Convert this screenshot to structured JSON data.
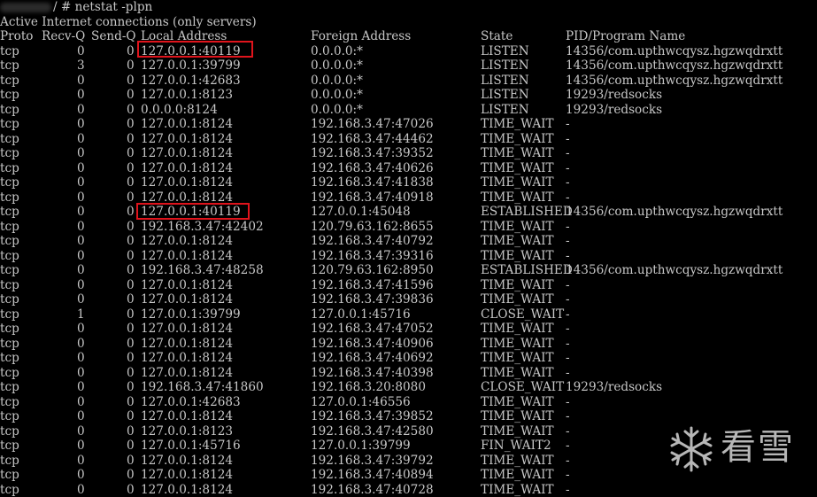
{
  "window": {
    "prompt_text": "/ # netstat -plpn",
    "title_line": "Active Internet connections (only servers)"
  },
  "header": {
    "proto": "Proto",
    "recvq": "Recv-Q",
    "sendq": "Send-Q",
    "local": "Local Address",
    "foreign": "Foreign Address",
    "state": "State",
    "pid": "PID/Program Name"
  },
  "rows": [
    {
      "proto": "tcp",
      "recvq": "0",
      "sendq": "0",
      "local": "127.0.0.1:40119",
      "foreign": "0.0.0.0:*",
      "state": "LISTEN",
      "pid": "14356/com.upthwcqysz.hgzwqdrxtt"
    },
    {
      "proto": "tcp",
      "recvq": "3",
      "sendq": "0",
      "local": "127.0.0.1:39799",
      "foreign": "0.0.0.0:*",
      "state": "LISTEN",
      "pid": "14356/com.upthwcqysz.hgzwqdrxtt"
    },
    {
      "proto": "tcp",
      "recvq": "0",
      "sendq": "0",
      "local": "127.0.0.1:42683",
      "foreign": "0.0.0.0:*",
      "state": "LISTEN",
      "pid": "14356/com.upthwcqysz.hgzwqdrxtt"
    },
    {
      "proto": "tcp",
      "recvq": "0",
      "sendq": "0",
      "local": "127.0.0.1:8123",
      "foreign": "0.0.0.0:*",
      "state": "LISTEN",
      "pid": "19293/redsocks"
    },
    {
      "proto": "tcp",
      "recvq": "0",
      "sendq": "0",
      "local": "0.0.0.0:8124",
      "foreign": "0.0.0.0:*",
      "state": "LISTEN",
      "pid": "19293/redsocks"
    },
    {
      "proto": "tcp",
      "recvq": "0",
      "sendq": "0",
      "local": "127.0.0.1:8124",
      "foreign": "192.168.3.47:47026",
      "state": "TIME_WAIT",
      "pid": "-"
    },
    {
      "proto": "tcp",
      "recvq": "0",
      "sendq": "0",
      "local": "127.0.0.1:8124",
      "foreign": "192.168.3.47:44462",
      "state": "TIME_WAIT",
      "pid": "-"
    },
    {
      "proto": "tcp",
      "recvq": "0",
      "sendq": "0",
      "local": "127.0.0.1:8124",
      "foreign": "192.168.3.47:39352",
      "state": "TIME_WAIT",
      "pid": "-"
    },
    {
      "proto": "tcp",
      "recvq": "0",
      "sendq": "0",
      "local": "127.0.0.1:8124",
      "foreign": "192.168.3.47:40626",
      "state": "TIME_WAIT",
      "pid": "-"
    },
    {
      "proto": "tcp",
      "recvq": "0",
      "sendq": "0",
      "local": "127.0.0.1:8124",
      "foreign": "192.168.3.47:41838",
      "state": "TIME_WAIT",
      "pid": "-"
    },
    {
      "proto": "tcp",
      "recvq": "0",
      "sendq": "0",
      "local": "127.0.0.1:8124",
      "foreign": "192.168.3.47:40918",
      "state": "TIME_WAIT",
      "pid": "-"
    },
    {
      "proto": "tcp",
      "recvq": "0",
      "sendq": "0",
      "local": "127.0.0.1:40119",
      "foreign": "127.0.0.1:45048",
      "state": "ESTABLISHED",
      "pid": "14356/com.upthwcqysz.hgzwqdrxtt"
    },
    {
      "proto": "tcp",
      "recvq": "0",
      "sendq": "0",
      "local": "192.168.3.47:42402",
      "foreign": "120.79.63.162:8655",
      "state": "TIME_WAIT",
      "pid": "-"
    },
    {
      "proto": "tcp",
      "recvq": "0",
      "sendq": "0",
      "local": "127.0.0.1:8124",
      "foreign": "192.168.3.47:40792",
      "state": "TIME_WAIT",
      "pid": "-"
    },
    {
      "proto": "tcp",
      "recvq": "0",
      "sendq": "0",
      "local": "127.0.0.1:8124",
      "foreign": "192.168.3.47:39316",
      "state": "TIME_WAIT",
      "pid": "-"
    },
    {
      "proto": "tcp",
      "recvq": "0",
      "sendq": "0",
      "local": "192.168.3.47:48258",
      "foreign": "120.79.63.162:8950",
      "state": "ESTABLISHED",
      "pid": "14356/com.upthwcqysz.hgzwqdrxtt"
    },
    {
      "proto": "tcp",
      "recvq": "0",
      "sendq": "0",
      "local": "127.0.0.1:8124",
      "foreign": "192.168.3.47:41596",
      "state": "TIME_WAIT",
      "pid": "-"
    },
    {
      "proto": "tcp",
      "recvq": "0",
      "sendq": "0",
      "local": "127.0.0.1:8124",
      "foreign": "192.168.3.47:39836",
      "state": "TIME_WAIT",
      "pid": "-"
    },
    {
      "proto": "tcp",
      "recvq": "1",
      "sendq": "0",
      "local": "127.0.0.1:39799",
      "foreign": "127.0.0.1:45716",
      "state": "CLOSE_WAIT",
      "pid": "-"
    },
    {
      "proto": "tcp",
      "recvq": "0",
      "sendq": "0",
      "local": "127.0.0.1:8124",
      "foreign": "192.168.3.47:47052",
      "state": "TIME_WAIT",
      "pid": "-"
    },
    {
      "proto": "tcp",
      "recvq": "0",
      "sendq": "0",
      "local": "127.0.0.1:8124",
      "foreign": "192.168.3.47:40906",
      "state": "TIME_WAIT",
      "pid": "-"
    },
    {
      "proto": "tcp",
      "recvq": "0",
      "sendq": "0",
      "local": "127.0.0.1:8124",
      "foreign": "192.168.3.47:40692",
      "state": "TIME_WAIT",
      "pid": "-"
    },
    {
      "proto": "tcp",
      "recvq": "0",
      "sendq": "0",
      "local": "127.0.0.1:8124",
      "foreign": "192.168.3.47:40398",
      "state": "TIME_WAIT",
      "pid": "-"
    },
    {
      "proto": "tcp",
      "recvq": "0",
      "sendq": "0",
      "local": "192.168.3.47:41860",
      "foreign": "192.168.3.20:8080",
      "state": "CLOSE_WAIT",
      "pid": "19293/redsocks"
    },
    {
      "proto": "tcp",
      "recvq": "0",
      "sendq": "0",
      "local": "127.0.0.1:42683",
      "foreign": "127.0.0.1:46556",
      "state": "TIME_WAIT",
      "pid": "-"
    },
    {
      "proto": "tcp",
      "recvq": "0",
      "sendq": "0",
      "local": "127.0.0.1:8124",
      "foreign": "192.168.3.47:39852",
      "state": "TIME_WAIT",
      "pid": "-"
    },
    {
      "proto": "tcp",
      "recvq": "0",
      "sendq": "0",
      "local": "127.0.0.1:8123",
      "foreign": "192.168.3.47:42580",
      "state": "TIME_WAIT",
      "pid": "-"
    },
    {
      "proto": "tcp",
      "recvq": "0",
      "sendq": "0",
      "local": "127.0.0.1:45716",
      "foreign": "127.0.0.1:39799",
      "state": "FIN_WAIT2",
      "pid": "-"
    },
    {
      "proto": "tcp",
      "recvq": "0",
      "sendq": "0",
      "local": "127.0.0.1:8124",
      "foreign": "192.168.3.47:39792",
      "state": "TIME_WAIT",
      "pid": "-"
    },
    {
      "proto": "tcp",
      "recvq": "0",
      "sendq": "0",
      "local": "127.0.0.1:8124",
      "foreign": "192.168.3.47:40894",
      "state": "TIME_WAIT",
      "pid": "-"
    },
    {
      "proto": "tcp",
      "recvq": "0",
      "sendq": "0",
      "local": "127.0.0.1:8124",
      "foreign": "192.168.3.47:40728",
      "state": "TIME_WAIT",
      "pid": "-"
    }
  ],
  "watermark": {
    "text": "看雪",
    "icon": "snowflake-icon",
    "color": "#d8d8d8"
  },
  "highlight_color": "#e0141c"
}
